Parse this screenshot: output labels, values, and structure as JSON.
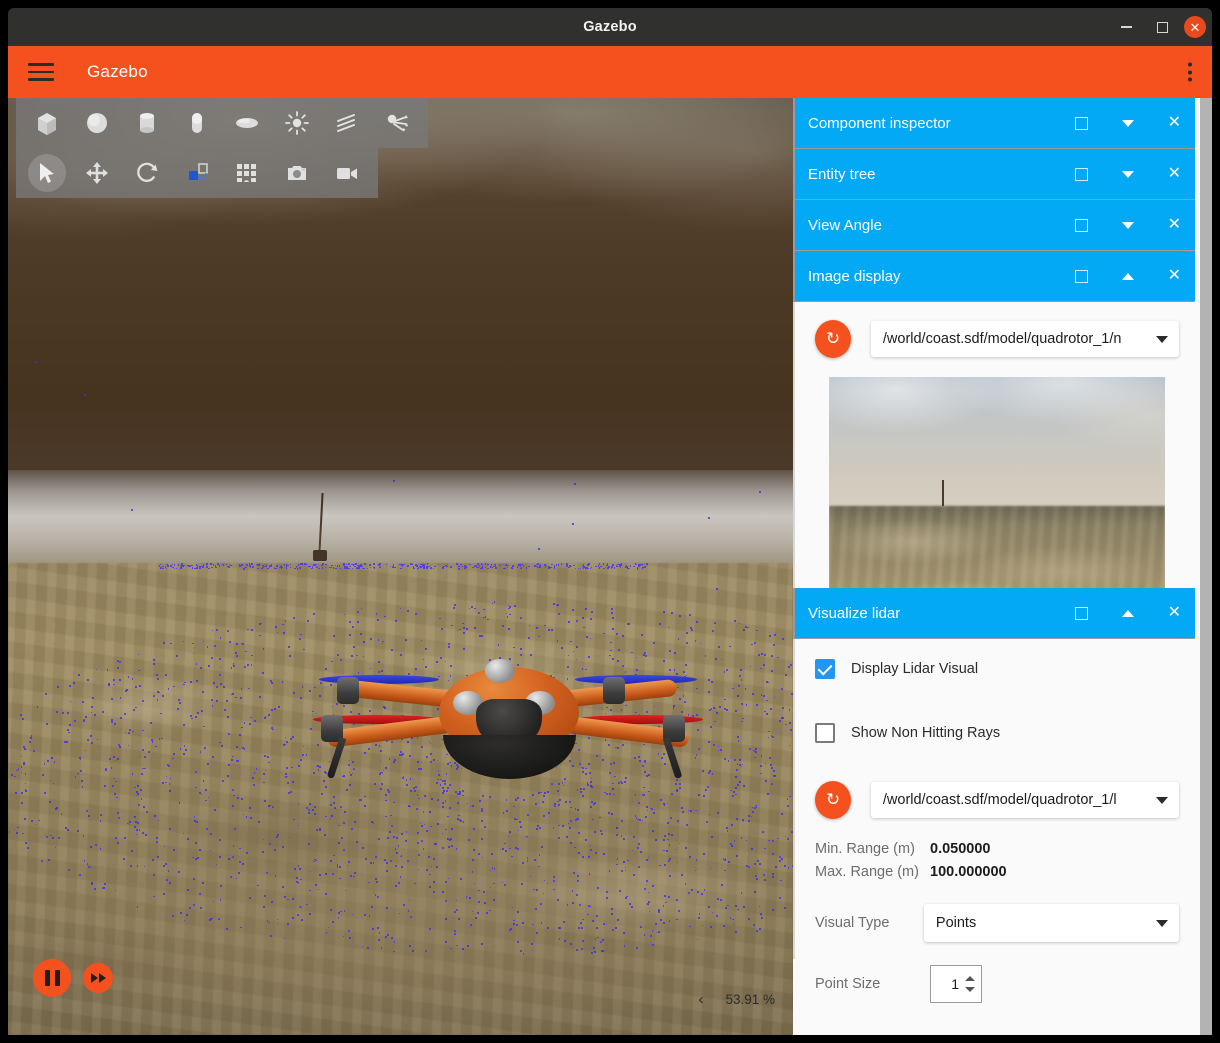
{
  "window": {
    "title": "Gazebo",
    "controls": {
      "minimize": "–",
      "maximize": "□",
      "close": "×"
    }
  },
  "appbar": {
    "title": "Gazebo",
    "menu_icon": "hamburger-icon",
    "overflow_icon": "kebab-menu-icon"
  },
  "toolbar_shapes": [
    {
      "name": "box-shape-icon",
      "label": "Box"
    },
    {
      "name": "sphere-shape-icon",
      "label": "Sphere"
    },
    {
      "name": "cylinder-shape-icon",
      "label": "Cylinder"
    },
    {
      "name": "capsule-shape-icon",
      "label": "Capsule"
    },
    {
      "name": "ellipsoid-shape-icon",
      "label": "Ellipsoid"
    },
    {
      "name": "point-light-icon",
      "label": "Point light"
    },
    {
      "name": "directional-light-icon",
      "label": "Directional light"
    },
    {
      "name": "spot-light-icon",
      "label": "Spot light"
    }
  ],
  "toolbar_tools": [
    {
      "name": "select-tool-icon",
      "label": "Select",
      "active": true
    },
    {
      "name": "translate-tool-icon",
      "label": "Translate",
      "active": false
    },
    {
      "name": "rotate-tool-icon",
      "label": "Rotate",
      "active": false
    },
    {
      "name": "transform-control-icon",
      "label": "Transform control",
      "active": false
    },
    {
      "name": "snap-grid-icon",
      "label": "Snap to grid",
      "active": false
    },
    {
      "name": "screenshot-camera-icon",
      "label": "Screenshot",
      "active": false
    },
    {
      "name": "video-record-icon",
      "label": "Record video",
      "active": false
    }
  ],
  "viewport": {
    "play_controls": {
      "pause_label": "Pause",
      "step_label": "Step"
    },
    "realtime_factor": "53.91 %",
    "prev_chevron": "‹"
  },
  "panels": [
    {
      "title": "Component inspector",
      "dock_icon": "dock-square-icon",
      "collapse_icon": "chevron-down-icon",
      "close_icon": "close-icon",
      "expanded": false
    },
    {
      "title": "Entity tree",
      "dock_icon": "dock-square-icon",
      "collapse_icon": "chevron-down-icon",
      "close_icon": "close-icon",
      "expanded": false
    },
    {
      "title": "View Angle",
      "dock_icon": "dock-square-icon",
      "collapse_icon": "chevron-down-icon",
      "close_icon": "close-icon",
      "expanded": false
    }
  ],
  "image_display": {
    "title": "Image display",
    "dock_icon": "dock-square-icon",
    "collapse_icon": "chevron-up-icon",
    "close_icon": "close-icon",
    "refresh_icon": "refresh-icon",
    "topic": "/world/coast.sdf/model/quadrotor_1/n",
    "topic_caret": "chevron-down-icon"
  },
  "visualize_lidar": {
    "title": "Visualize lidar",
    "dock_icon": "dock-square-icon",
    "collapse_icon": "chevron-up-icon",
    "close_icon": "close-icon",
    "display_lidar_label": "Display Lidar Visual",
    "display_lidar_checked": true,
    "show_non_hitting_label": "Show Non Hitting Rays",
    "show_non_hitting_checked": false,
    "refresh_icon": "refresh-icon",
    "topic": "/world/coast.sdf/model/quadrotor_1/l",
    "min_range_label": "Min. Range (m)",
    "min_range_value": "0.050000",
    "max_range_label": "Max. Range (m)",
    "max_range_value": "100.000000",
    "visual_type_label": "Visual Type",
    "visual_type_value": "Points",
    "point_size_label": "Point Size",
    "point_size_value": "1"
  },
  "colors": {
    "accent_orange": "#f4511e",
    "panel_blue": "#03a9f4",
    "titlebar_dark": "#30302f",
    "close_red": "#e8491d",
    "lidar_point": "#3a2ef0"
  }
}
